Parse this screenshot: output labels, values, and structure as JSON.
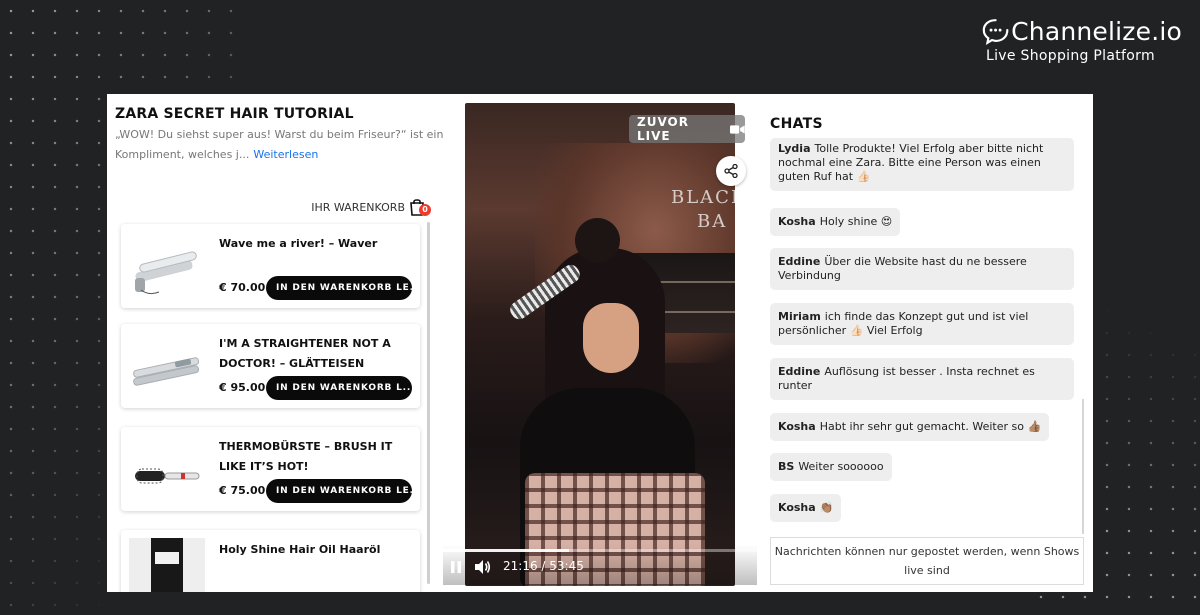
{
  "brand": {
    "name": "Channelize.io",
    "tagline": "Live Shopping Platform"
  },
  "show": {
    "title": "ZARA SECRET HAIR TUTORIAL",
    "description": "„WOW! Du siehst super aus! Warst du beim Friseur?“ ist ein Kompliment, welches j...",
    "read_more": "Weiterlesen"
  },
  "cart": {
    "label": "IHR WARENKORB",
    "count": "0"
  },
  "products": [
    {
      "name": "Wave me a river! – Waver",
      "price": "€ 70.00",
      "button": "IN DEN WARENKORB LE..."
    },
    {
      "name": "I'M A STRAIGHTENER NOT A DOCTOR! – GLÄTTEISEN",
      "price": "€ 95.00",
      "button": "IN DEN WARENKORB L..."
    },
    {
      "name": "THERMOBÜRSTE – BRUSH IT LIKE IT’S HOT!",
      "price": "€ 75.00",
      "button": "IN DEN WARENKORB LE..."
    },
    {
      "name": "Holy Shine Hair Oil Haaröl",
      "price": "",
      "button": ""
    }
  ],
  "video": {
    "live_tag": "ZUVOR LIVE",
    "sign_line1": "BLACK",
    "sign_line2": "BA",
    "time": "21:16 / 53:45",
    "progress": 0.4
  },
  "chats": {
    "title": "CHATS",
    "messages": [
      {
        "user": "Lydia",
        "text": "Tolle Produkte! Viel Erfolg aber bitte nicht nochmal eine Zara. Bitte eine Person was einen guten Ruf hat 👍🏻"
      },
      {
        "user": "Kosha",
        "text": "Holy shine 😍"
      },
      {
        "user": "Eddine",
        "text": "Über die Website hast du ne bessere Verbindung"
      },
      {
        "user": "Miriam",
        "text": "ich finde das Konzept gut und ist viel persönlicher 👍🏻 Viel Erfolg"
      },
      {
        "user": "Eddine",
        "text": "Auflösung ist besser . Insta rechnet es runter"
      },
      {
        "user": "Kosha",
        "text": "Habt ihr sehr gut gemacht. Weiter so 👍🏽"
      },
      {
        "user": "BS",
        "text": "Weiter soooooo"
      },
      {
        "user": "Kosha",
        "text": "👏🏽"
      }
    ],
    "footer": "Nachrichten können nur gepostet werden, wenn Shows live sind"
  }
}
